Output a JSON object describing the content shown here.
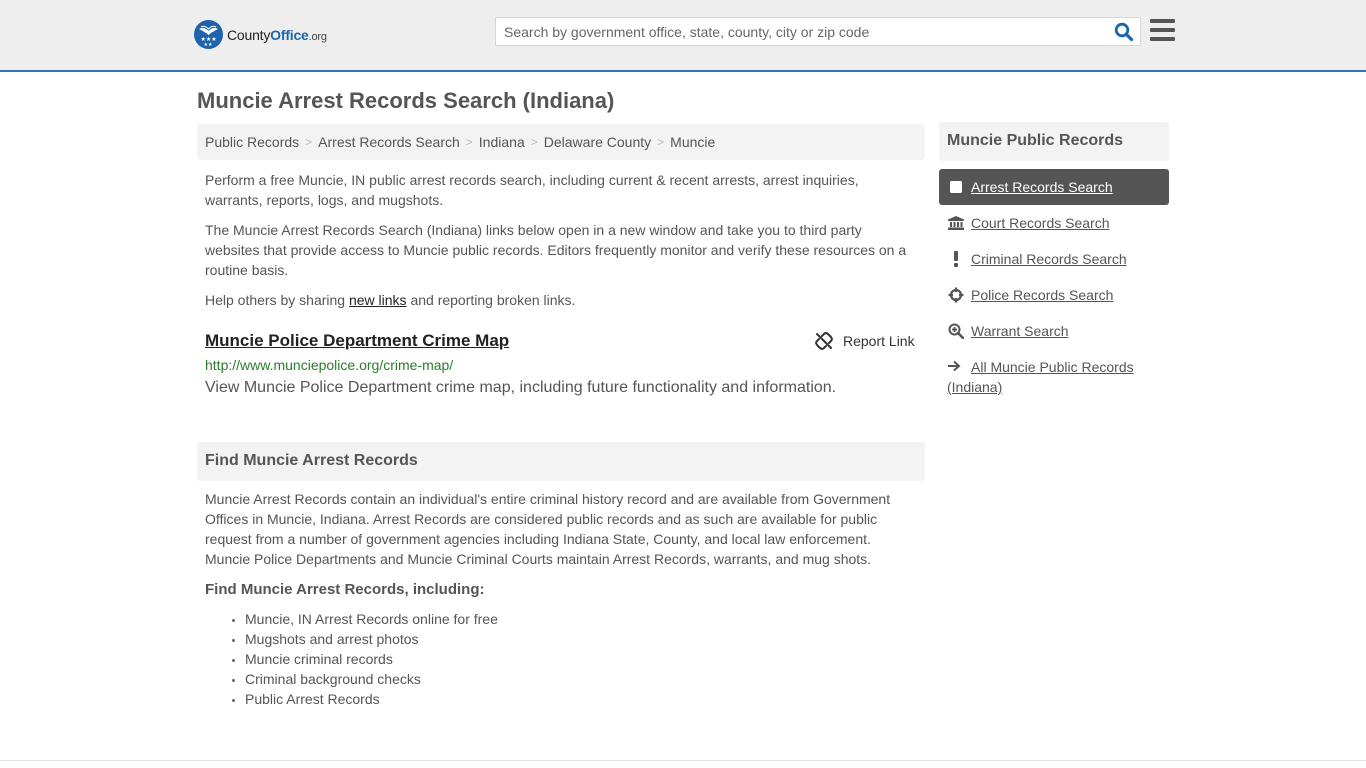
{
  "header": {
    "logo": {
      "county": "County",
      "office": "Office",
      "org": ".org"
    },
    "search": {
      "placeholder": "Search by government office, state, county, city or zip code",
      "value": ""
    },
    "brand_color": "#1d64ad",
    "accent_line_color": "#2f74b0"
  },
  "page_title": "Muncie Arrest Records Search (Indiana)",
  "breadcrumb": [
    {
      "label": "Public Records"
    },
    {
      "label": "Arrest Records Search"
    },
    {
      "label": "Indiana"
    },
    {
      "label": "Delaware County"
    },
    {
      "label": "Muncie"
    }
  ],
  "intro": {
    "p1": "Perform a free Muncie, IN public arrest records search, including current & recent arrests, arrest inquiries, warrants, reports, logs, and mugshots.",
    "p2": "The Muncie Arrest Records Search (Indiana) links below open in a new window and take you to third party websites that provide access to Muncie public records. Editors frequently monitor and verify these resources on a routine basis.",
    "p3_before": "Help others by sharing ",
    "p3_link": "new links",
    "p3_after": " and reporting broken links."
  },
  "links": [
    {
      "title": "Muncie Police Department Crime Map",
      "url": "http://www.munciepolice.org/crime-map/",
      "description": "View Muncie Police Department crime map, including future functionality and information.",
      "report_label": "Report Link"
    }
  ],
  "find_section": {
    "heading": "Find Muncie Arrest Records",
    "body": "Muncie Arrest Records contain an individual's entire criminal history record and are available from Government Offices in Muncie, Indiana. Arrest Records are considered public records and as such are available for public request from a number of government agencies including Indiana State, County, and local law enforcement. Muncie Police Departments and Muncie Criminal Courts maintain Arrest Records, warrants, and mug shots.",
    "subheading": "Find Muncie Arrest Records, including:",
    "bullets": [
      "Muncie, IN Arrest Records online for free",
      "Mugshots and arrest photos",
      "Muncie criminal records",
      "Criminal background checks",
      "Public Arrest Records"
    ]
  },
  "sidebar": {
    "heading": "Muncie Public Records",
    "items": [
      {
        "label": "Arrest Records Search",
        "icon": "square-icon",
        "active": true
      },
      {
        "label": "Court Records Search",
        "icon": "courthouse-icon",
        "active": false
      },
      {
        "label": "Criminal Records Search",
        "icon": "exclamation-icon",
        "active": false
      },
      {
        "label": "Police Records Search",
        "icon": "crosshairs-icon",
        "active": false
      },
      {
        "label": "Warrant Search",
        "icon": "zoom-in-icon",
        "active": false
      }
    ],
    "all_link": {
      "label": "All Muncie Public Records (Indiana)",
      "icon": "arrow-right-icon"
    }
  }
}
